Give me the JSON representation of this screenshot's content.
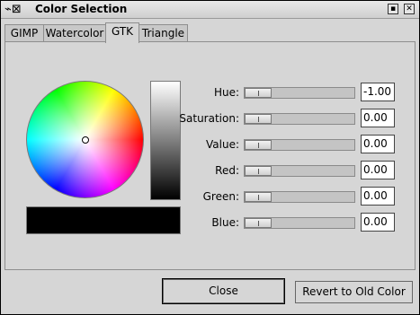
{
  "window": {
    "title": "Color Selection",
    "icon": "gimp-brush-icon",
    "controls": [
      "maximize-icon",
      "close-icon"
    ]
  },
  "tabs": [
    {
      "label": "GIMP"
    },
    {
      "label": "Watercolor"
    },
    {
      "label": "GTK",
      "active": true
    },
    {
      "label": "Triangle"
    }
  ],
  "color": {
    "selected": "#000000"
  },
  "fields": [
    {
      "label": "Hue:",
      "value": "-1.00",
      "level": 0
    },
    {
      "label": "Saturation:",
      "value": "0.00",
      "level": 0
    },
    {
      "label": "Value:",
      "value": "0.00",
      "level": 0
    },
    {
      "label": "Red:",
      "value": "0.00",
      "level": 0
    },
    {
      "label": "Green:",
      "value": "0.00",
      "level": 0
    },
    {
      "label": "Blue:",
      "value": "0.00",
      "level": 0
    }
  ],
  "buttons": {
    "close": "Close",
    "revert": "Revert to Old Color"
  }
}
